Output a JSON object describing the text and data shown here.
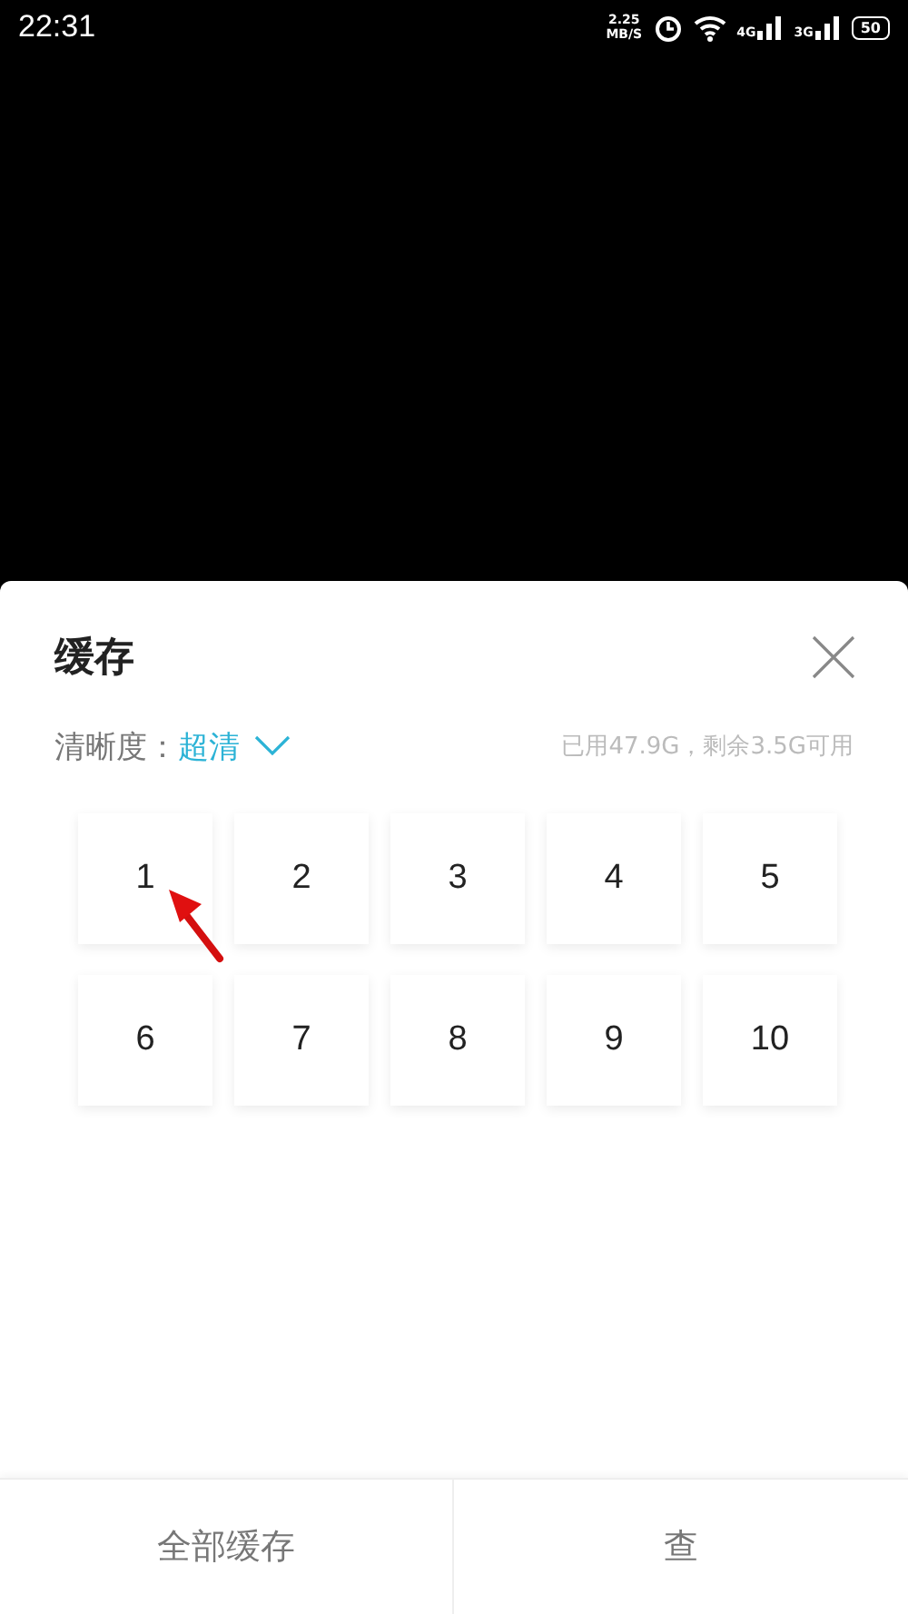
{
  "status_bar": {
    "time": "22:31",
    "speed_value": "2.25",
    "speed_unit": "MB/S",
    "network_1": "4G",
    "network_2": "3G",
    "battery": "50"
  },
  "sheet": {
    "title": "缓存",
    "quality_label": "清晰度：",
    "quality_value": "超清",
    "storage": "已用47.9G，剩余3.5G可用",
    "episodes": [
      {
        "label": "1",
        "pointed": true
      },
      {
        "label": "2",
        "pointed": false
      },
      {
        "label": "3",
        "pointed": false
      },
      {
        "label": "4",
        "pointed": false
      },
      {
        "label": "5",
        "pointed": false
      },
      {
        "label": "6",
        "pointed": false
      },
      {
        "label": "7",
        "pointed": false
      },
      {
        "label": "8",
        "pointed": false
      },
      {
        "label": "9",
        "pointed": false
      },
      {
        "label": "10",
        "pointed": false
      }
    ],
    "buttons": [
      "全部缓存",
      "查"
    ]
  }
}
